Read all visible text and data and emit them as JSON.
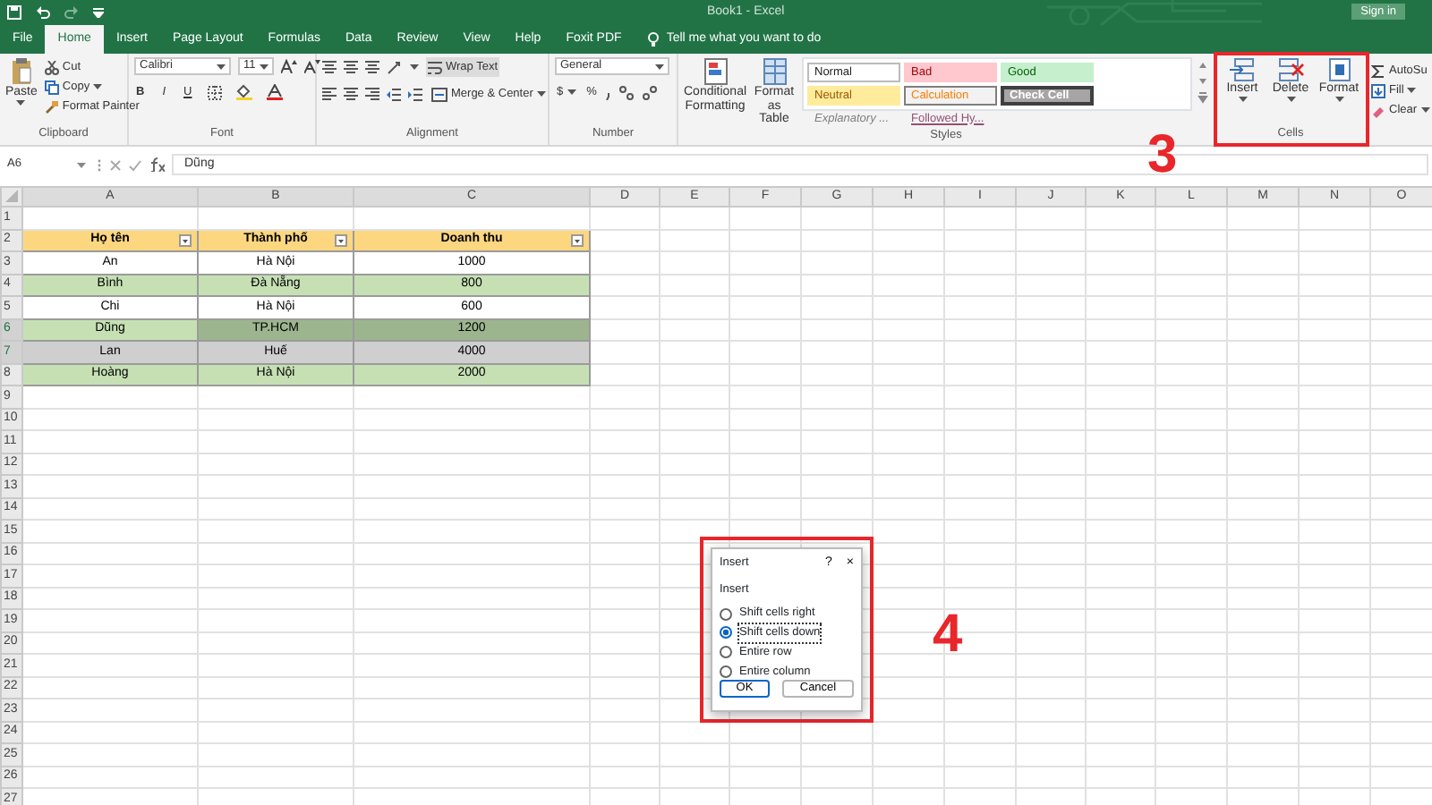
{
  "window": {
    "title": "Book1 - Excel",
    "sign_in": "Sign in"
  },
  "tabs": [
    {
      "label": "File",
      "selected": false
    },
    {
      "label": "Home",
      "selected": true
    },
    {
      "label": "Insert",
      "selected": false
    },
    {
      "label": "Page Layout",
      "selected": false
    },
    {
      "label": "Formulas",
      "selected": false
    },
    {
      "label": "Data",
      "selected": false
    },
    {
      "label": "Review",
      "selected": false
    },
    {
      "label": "View",
      "selected": false
    },
    {
      "label": "Help",
      "selected": false
    },
    {
      "label": "Foxit PDF",
      "selected": false
    }
  ],
  "tell_me": "Tell me what you want to do",
  "ribbon": {
    "clipboard": {
      "label": "Clipboard",
      "paste": "Paste",
      "cut": "Cut",
      "copy": "Copy",
      "format_painter": "Format Painter"
    },
    "font": {
      "label": "Font",
      "name": "Calibri",
      "size": "11",
      "bold": "B",
      "italic": "I",
      "underline": "U"
    },
    "alignment": {
      "label": "Alignment",
      "wrap_text": "Wrap Text",
      "merge_center": "Merge & Center"
    },
    "number": {
      "label": "Number",
      "format": "General",
      "currency": "$",
      "percent": "%"
    },
    "styles": {
      "label": "Styles",
      "conditional_formatting": "Conditional Formatting",
      "format_as_table": "Format as Table",
      "gallery": [
        {
          "label": "Normal",
          "kind": "normal"
        },
        {
          "label": "Bad",
          "kind": "bad"
        },
        {
          "label": "Good",
          "kind": "good"
        },
        {
          "label": "Neutral",
          "kind": "neutral"
        },
        {
          "label": "Calculation",
          "kind": "calculation"
        },
        {
          "label": "Check Cell",
          "kind": "check"
        },
        {
          "label": "Explanatory ...",
          "kind": "explanatory"
        },
        {
          "label": "Followed Hy...",
          "kind": "followed"
        }
      ]
    },
    "cells": {
      "label": "Cells",
      "buttons": [
        "Insert",
        "Delete",
        "Format"
      ]
    },
    "editing": {
      "autosum": "AutoSu",
      "fill": "Fill",
      "clear": "Clear"
    }
  },
  "formula_bar": {
    "name_box": "A6",
    "value": "Dũng"
  },
  "sheet": {
    "columns": [
      "A",
      "B",
      "C",
      "D",
      "E",
      "F",
      "G",
      "H",
      "I",
      "J",
      "K",
      "L",
      "M",
      "N",
      "O"
    ],
    "row_numbers": [
      "1",
      "2",
      "3",
      "4",
      "5",
      "6",
      "7",
      "8",
      "9",
      "10",
      "11",
      "12",
      "13",
      "14",
      "15",
      "16",
      "17",
      "18",
      "19",
      "20",
      "21",
      "22",
      "23",
      "24",
      "25",
      "26",
      "27"
    ],
    "table": {
      "headers": [
        "Họ tên",
        "Thành phố",
        "Doanh thu"
      ],
      "rows": [
        {
          "cells": [
            "An",
            "Hà Nội",
            "1000"
          ],
          "banded": false,
          "selected": false
        },
        {
          "cells": [
            "Bình",
            "Đà Nẵng",
            "800"
          ],
          "banded": true,
          "selected": false
        },
        {
          "cells": [
            "Chi",
            "Hà Nội",
            "600"
          ],
          "banded": false,
          "selected": false
        },
        {
          "cells": [
            "Dũng",
            "TP.HCM",
            "1200"
          ],
          "banded": true,
          "selected": true
        },
        {
          "cells": [
            "Lan",
            "Huế",
            "4000"
          ],
          "banded": false,
          "selected": true
        },
        {
          "cells": [
            "Hoàng",
            "Hà Nội",
            "2000"
          ],
          "banded": true,
          "selected": false
        }
      ]
    }
  },
  "dialog": {
    "title": "Insert",
    "help": "?",
    "close": "×",
    "group_label": "Insert",
    "options": [
      {
        "label": "Shift cells right",
        "selected": false
      },
      {
        "label": "Shift cells down",
        "selected": true
      },
      {
        "label": "Entire row",
        "selected": false
      },
      {
        "label": "Entire column",
        "selected": false
      }
    ],
    "buttons": [
      "OK",
      "Cancel"
    ]
  },
  "annotations": [
    {
      "label": "3"
    },
    {
      "label": "4"
    }
  ]
}
